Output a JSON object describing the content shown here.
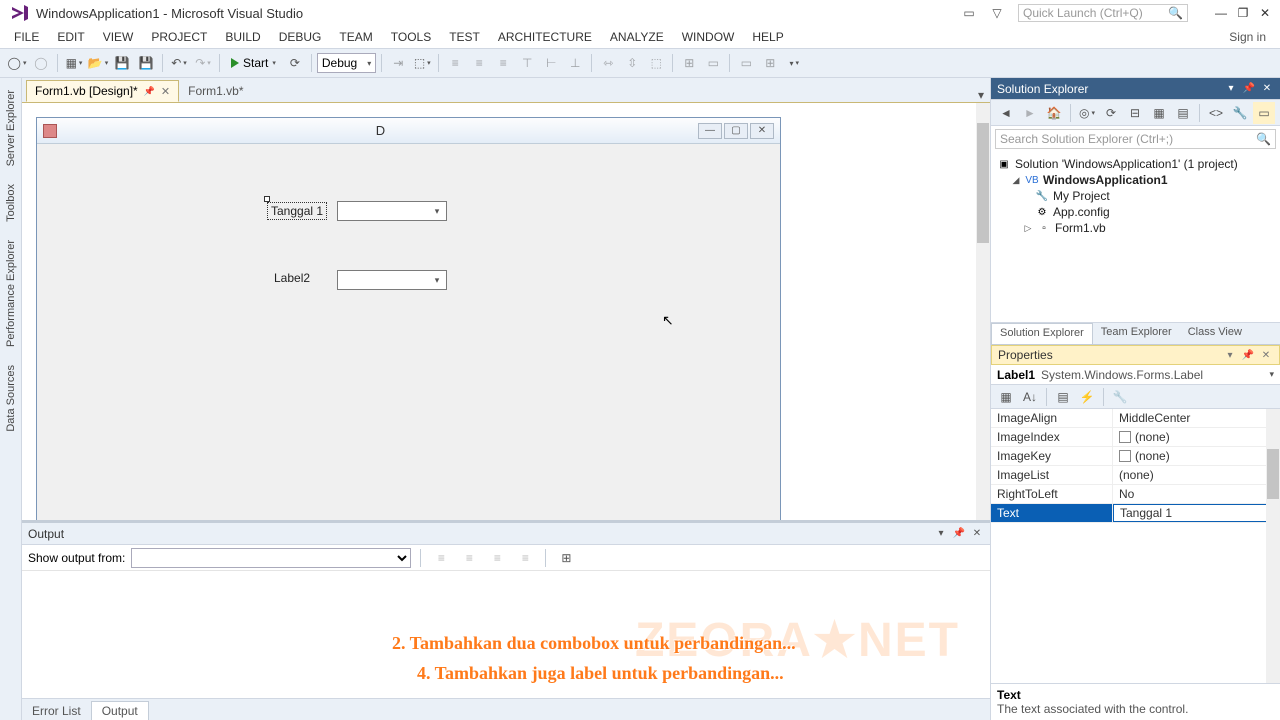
{
  "title": "WindowsApplication1 - Microsoft Visual Studio",
  "quick_launch_placeholder": "Quick Launch (Ctrl+Q)",
  "sign_in": "Sign in",
  "menu": [
    "FILE",
    "EDIT",
    "VIEW",
    "PROJECT",
    "BUILD",
    "DEBUG",
    "TEAM",
    "TOOLS",
    "TEST",
    "ARCHITECTURE",
    "ANALYZE",
    "WINDOW",
    "HELP"
  ],
  "toolbar": {
    "start": "Start",
    "config": "Debug"
  },
  "left_rail": [
    "Server Explorer",
    "Toolbox",
    "Performance Explorer",
    "Data Sources"
  ],
  "doc_tabs": {
    "active": "Form1.vb [Design]*",
    "inactive": "Form1.vb*"
  },
  "form": {
    "caption": "D",
    "label1": "Tanggal 1",
    "label2": "Label2"
  },
  "output": {
    "title": "Output",
    "show_from": "Show output from:"
  },
  "overlay": {
    "line1": "2. Tambahkan dua combobox untuk perbandingan...",
    "line2": "4. Tambahkan juga label untuk perbandingan...",
    "watermark": "ZEORA★NET"
  },
  "bottom_tabs": {
    "error_list": "Error List",
    "output": "Output"
  },
  "solution_explorer": {
    "title": "Solution Explorer",
    "search_placeholder": "Search Solution Explorer (Ctrl+;)",
    "root": "Solution 'WindowsApplication1' (1 project)",
    "project": "WindowsApplication1",
    "items": [
      "My Project",
      "App.config",
      "Form1.vb"
    ],
    "tabs": [
      "Solution Explorer",
      "Team Explorer",
      "Class View"
    ]
  },
  "properties": {
    "title": "Properties",
    "object_name": "Label1",
    "object_type": "System.Windows.Forms.Label",
    "rows": [
      {
        "name": "ImageAlign",
        "value": "MiddleCenter",
        "check": false
      },
      {
        "name": "ImageIndex",
        "value": "(none)",
        "check": true
      },
      {
        "name": "ImageKey",
        "value": "(none)",
        "check": true
      },
      {
        "name": "ImageList",
        "value": "(none)",
        "check": false
      },
      {
        "name": "RightToLeft",
        "value": "No",
        "check": false
      },
      {
        "name": "Text",
        "value": "Tanggal 1",
        "check": false,
        "selected": true
      }
    ],
    "desc_title": "Text",
    "desc_text": "The text associated with the control."
  }
}
